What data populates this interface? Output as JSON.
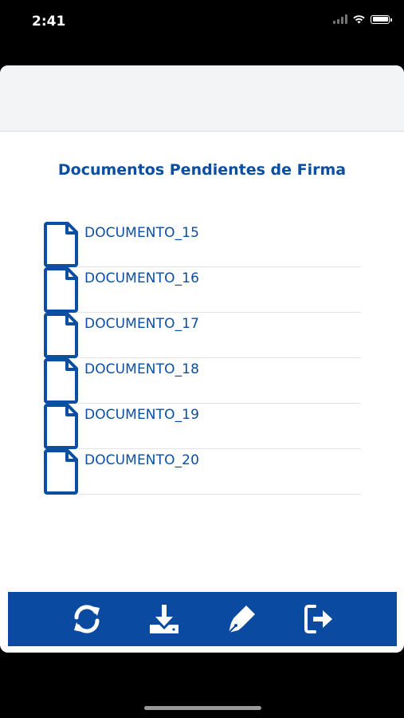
{
  "status_bar": {
    "time": "2:41"
  },
  "page": {
    "title": "Documentos Pendientes de Firma"
  },
  "documents": [
    {
      "label": "DOCUMENTO_15",
      "icon": "document-icon"
    },
    {
      "label": "DOCUMENTO_16",
      "icon": "document-icon"
    },
    {
      "label": "DOCUMENTO_17",
      "icon": "document-icon"
    },
    {
      "label": "DOCUMENTO_18",
      "icon": "document-icon"
    },
    {
      "label": "DOCUMENTO_19",
      "icon": "document-icon"
    },
    {
      "label": "DOCUMENTO_20",
      "icon": "document-icon"
    }
  ],
  "toolbar": {
    "buttons": [
      {
        "icon": "refresh-icon"
      },
      {
        "icon": "download-icon"
      },
      {
        "icon": "sign-pen-icon"
      },
      {
        "icon": "logout-icon"
      }
    ]
  },
  "colors": {
    "primary": "#0b4ea2",
    "toolbar_bg": "#0b4aa1",
    "outer_bg": "#000000",
    "sheet_bg": "#ffffff"
  }
}
